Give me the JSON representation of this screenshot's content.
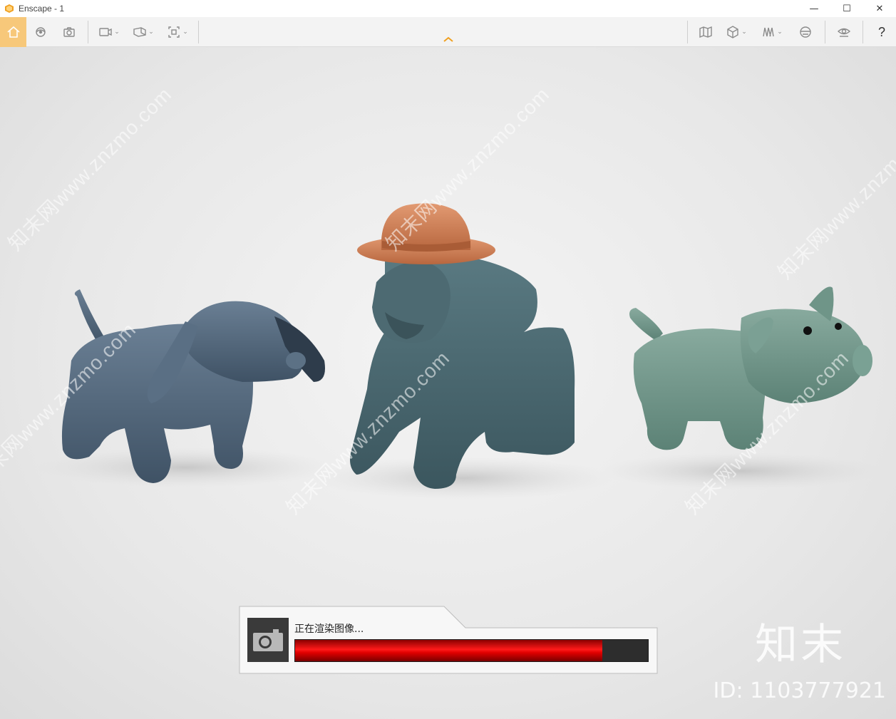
{
  "window": {
    "title": "Enscape - 1",
    "controls": {
      "minimize": "—",
      "maximize": "☐",
      "close": "✕"
    }
  },
  "toolbar": {
    "left_icons": [
      "home-icon",
      "orbit-icon",
      "screenshot-icon",
      "video-editor-icon",
      "panorama-icon",
      "batch-render-icon"
    ],
    "right_icons": [
      "map-icon",
      "cube-icon",
      "asset-library-icon",
      "vr-headset-icon",
      "visual-settings-icon"
    ],
    "help_label": "?",
    "accent_color": "#f7c87a",
    "collapse_color": "#f0a020"
  },
  "viewport": {
    "watermark_text": "知末网www.znzmo.com",
    "brand_mark": "知末",
    "brand_id": "ID: 1103777921"
  },
  "render_status": {
    "label": "正在渲染图像...",
    "progress": 0.87,
    "bar_color": "#e00000"
  }
}
